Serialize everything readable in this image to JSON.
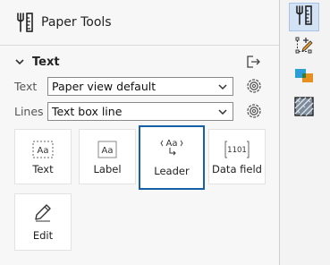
{
  "header": {
    "title": "Paper Tools",
    "icon": "paper-tools-icon"
  },
  "section": {
    "label": "Text",
    "expanded": true
  },
  "fields": [
    {
      "label": "Text",
      "value": "Paper view default"
    },
    {
      "label": "Lines",
      "value": "Text box line"
    }
  ],
  "tools": [
    {
      "label": "Text",
      "icon": "text-box-icon",
      "selected": false
    },
    {
      "label": "Label",
      "icon": "label-icon",
      "selected": false
    },
    {
      "label": "Leader",
      "icon": "leader-icon",
      "selected": true,
      "icon_text": "Aa"
    },
    {
      "label": "Data field",
      "icon": "data-field-icon",
      "selected": false,
      "icon_text": "1101"
    },
    {
      "label": "Edit",
      "icon": "pencil-icon",
      "selected": false
    }
  ],
  "tool_icon_text": {
    "text": "Aa",
    "label": "Aa"
  },
  "rail": [
    {
      "icon": "paper-tools-icon",
      "active": true
    },
    {
      "icon": "shape-edit-icon",
      "active": false
    },
    {
      "icon": "layers-color-icon",
      "active": false
    },
    {
      "icon": "hatch-pattern-icon",
      "active": false
    }
  ],
  "colors": {
    "accent": "#1660a6",
    "rail_active": "#d4e2f5"
  }
}
